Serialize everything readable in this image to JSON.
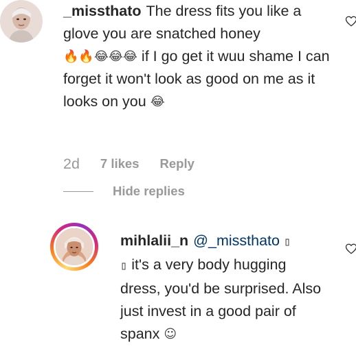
{
  "comment": {
    "username": "_missthato",
    "text_1": "The dress fits you like a glove you are snatched honey",
    "emoji_fire": "🔥🔥",
    "emoji_faces": "😂😂😂",
    "text_2": "if I go get it wuu shame I can forget it won't look as good on me as it looks on you",
    "emoji_end": "😂",
    "time": "2d",
    "likes": "7 likes",
    "reply_label": "Reply",
    "like_icon": "heart-outline-icon"
  },
  "thread": {
    "hide_replies_label": "Hide replies"
  },
  "reply": {
    "username": "mihlalii_n",
    "mention": "@_missthato",
    "missing_glyph": "▯",
    "text": "it's a very body hugging dress, you'd be surprised. Also just invest in a good pair of spanx",
    "emoji_end": "☺",
    "like_icon": "heart-outline-icon"
  },
  "colors": {
    "text": "#262626",
    "secondary": "#999999",
    "mention": "#003569",
    "story_ring": [
      "#feda75",
      "#fa7e1e",
      "#d62976",
      "#962fbf"
    ]
  }
}
